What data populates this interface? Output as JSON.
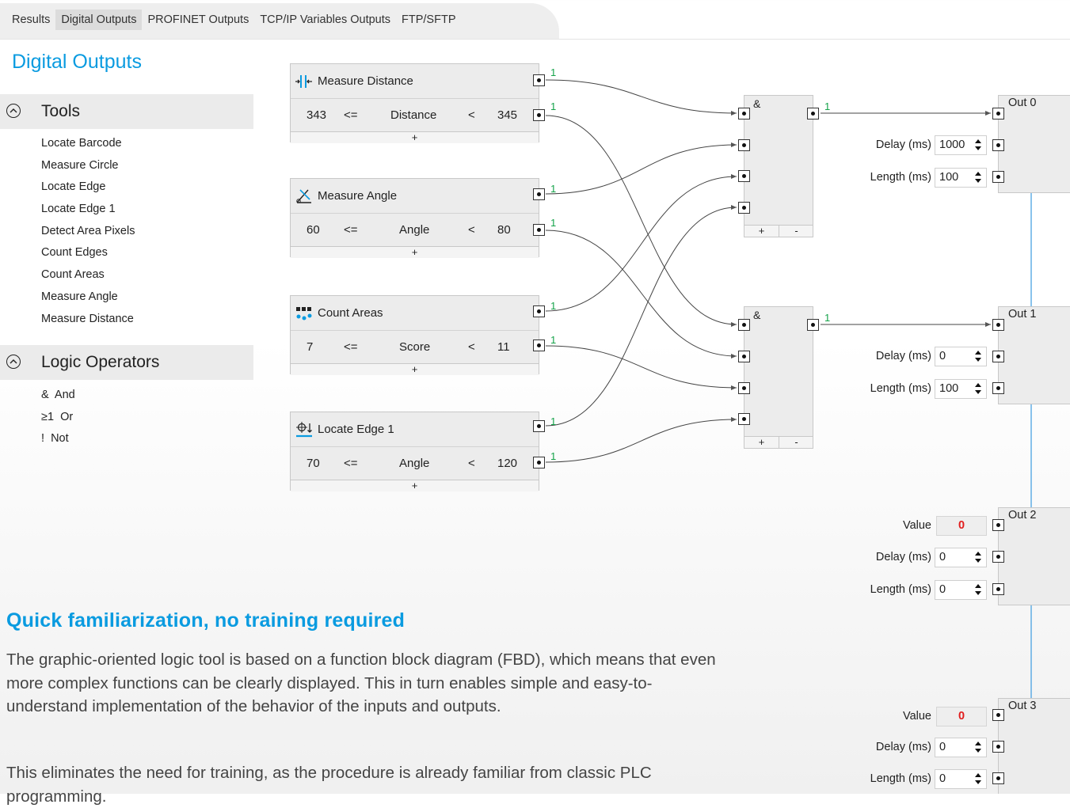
{
  "tabs": [
    "Results",
    "Digital Outputs",
    "PROFINET Outputs",
    "TCP/IP Variables Outputs",
    "FTP/SFTP"
  ],
  "active_tab": "Digital Outputs",
  "page_title": "Digital Outputs",
  "tools_section": {
    "label": "Tools",
    "items": [
      "Locate Barcode",
      "Measure Circle",
      "Locate Edge",
      "Locate Edge 1",
      "Detect Area Pixels",
      "Count Edges",
      "Count Areas",
      "Measure Angle",
      "Measure Distance"
    ]
  },
  "logic_section": {
    "label": "Logic Operators",
    "items": [
      "&  And",
      "≥1  Or",
      "!  Not"
    ]
  },
  "tool_blocks": [
    {
      "name": "Measure Distance",
      "icon": "measure-distance-icon",
      "min": "343",
      "op1": "<=",
      "param": "Distance",
      "op2": "<",
      "max": "345",
      "plus": "+",
      "out1": "1",
      "out2": "1"
    },
    {
      "name": "Measure Angle",
      "icon": "measure-angle-icon",
      "min": "60",
      "op1": "<=",
      "param": "Angle",
      "op2": "<",
      "max": "80",
      "plus": "+",
      "out1": "1",
      "out2": "1"
    },
    {
      "name": "Count Areas",
      "icon": "count-areas-icon",
      "min": "7",
      "op1": "<=",
      "param": "Score",
      "op2": "<",
      "max": "11",
      "plus": "+",
      "out1": "1",
      "out2": "1"
    },
    {
      "name": "Locate Edge 1",
      "icon": "locate-edge-icon",
      "min": "70",
      "op1": "<=",
      "param": "Angle",
      "op2": "<",
      "max": "120",
      "plus": "+",
      "out1": "1",
      "out2": "1"
    }
  ],
  "gates": [
    {
      "symbol": "&",
      "out": "1",
      "add": "+",
      "remove": "-"
    },
    {
      "symbol": "&",
      "out": "1",
      "add": "+",
      "remove": "-"
    }
  ],
  "outputs": [
    {
      "name": "Out 0",
      "delay_label": "Delay (ms)",
      "delay": "1000",
      "length_label": "Length (ms)",
      "length": "100"
    },
    {
      "name": "Out 1",
      "delay_label": "Delay (ms)",
      "delay": "0",
      "length_label": "Length (ms)",
      "length": "100"
    },
    {
      "name": "Out 2",
      "value_label": "Value",
      "value": "0",
      "delay_label": "Delay (ms)",
      "delay": "0",
      "length_label": "Length (ms)",
      "length": "0"
    },
    {
      "name": "Out 3",
      "value_label": "Value",
      "value": "0",
      "delay_label": "Delay (ms)",
      "delay": "0",
      "length_label": "Length (ms)",
      "length": "0"
    }
  ],
  "colors": {
    "accent": "#0a9be0",
    "signal_green": "#16a34a",
    "value_red": "#e11d1d",
    "link_blue": "#3b9be0"
  },
  "marketing": {
    "title": "Quick familiarization, no training required",
    "p1": "The graphic-oriented logic tool is based on a function block diagram (FBD), which means that even more complex functions can be clearly displayed. This in turn enables simple and easy-to-understand implementation of the behavior of the inputs and outputs.",
    "p2": "This eliminates the need for training, as the procedure is already familiar from classic PLC programming."
  }
}
